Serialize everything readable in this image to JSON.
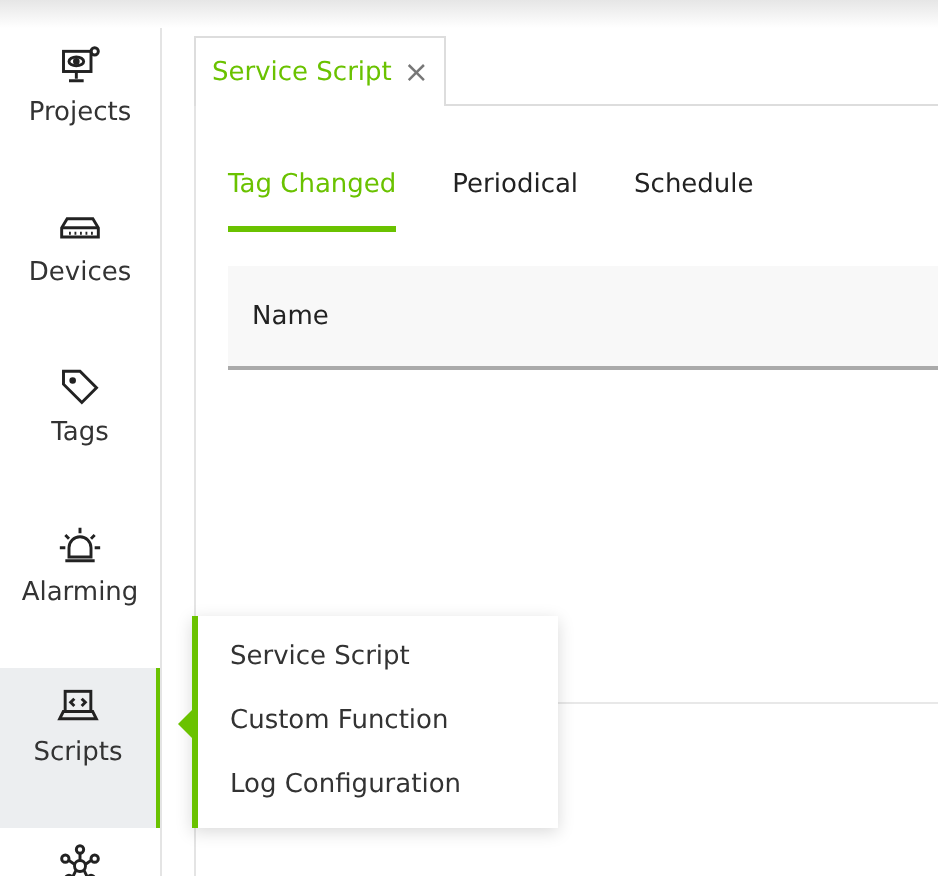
{
  "sidebar": {
    "items": [
      {
        "label": "Projects",
        "selected": false
      },
      {
        "label": "Devices",
        "selected": false
      },
      {
        "label": "Tags",
        "selected": false
      },
      {
        "label": "Alarming",
        "selected": false
      },
      {
        "label": "Scripts",
        "selected": true
      },
      {
        "selected": false
      }
    ]
  },
  "tabs": [
    {
      "label": "Service Script",
      "close": "×",
      "selected": true
    }
  ],
  "subtabs": [
    {
      "label": "Tag Changed",
      "selected": true
    },
    {
      "label": "Periodical",
      "selected": false
    },
    {
      "label": "Schedule",
      "selected": false
    }
  ],
  "table": {
    "columns": [
      "Name"
    ]
  },
  "popup_menu": {
    "items": [
      "Service Script",
      "Custom Function",
      "Log Configuration"
    ]
  }
}
